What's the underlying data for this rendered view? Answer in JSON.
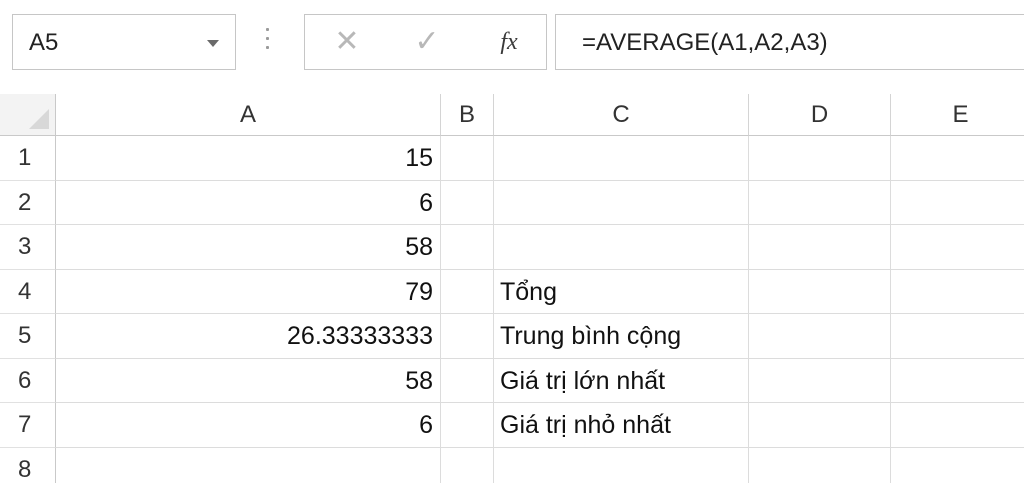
{
  "formula_bar": {
    "name_box": "A5",
    "cancel_icon": "✕",
    "enter_icon": "✓",
    "fx_label": "fx",
    "formula": "=AVERAGE(A1,A2,A3)"
  },
  "columns": [
    "A",
    "B",
    "C",
    "D",
    "E"
  ],
  "rows": [
    {
      "num": "1",
      "A": "15",
      "C": ""
    },
    {
      "num": "2",
      "A": "6",
      "C": ""
    },
    {
      "num": "3",
      "A": "58",
      "C": ""
    },
    {
      "num": "4",
      "A": "79",
      "C": "Tổng"
    },
    {
      "num": "5",
      "A": "26.33333333",
      "C": "Trung bình cộng"
    },
    {
      "num": "6",
      "A": "58",
      "C": "Giá trị lớn nhất"
    },
    {
      "num": "7",
      "A": "6",
      "C": "Giá trị nhỏ nhất"
    },
    {
      "num": "8",
      "A": "",
      "C": ""
    }
  ]
}
